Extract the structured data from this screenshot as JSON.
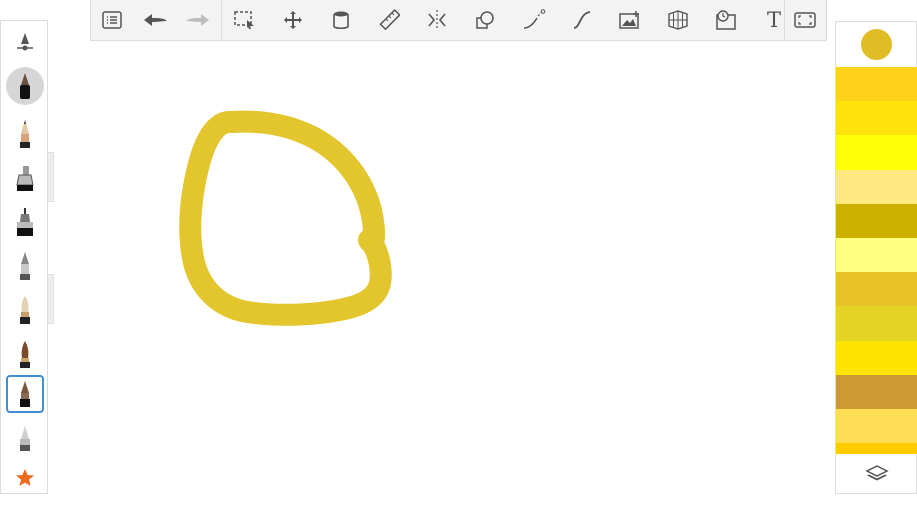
{
  "toolbar": {
    "items": [
      {
        "name": "list-menu-icon"
      },
      {
        "name": "undo-icon"
      },
      {
        "name": "redo-icon"
      },
      {
        "name": "selection-icon"
      },
      {
        "name": "transform-icon"
      },
      {
        "name": "fill-bucket-icon"
      },
      {
        "name": "ruler-icon"
      },
      {
        "name": "symmetry-icon"
      },
      {
        "name": "shapes-icon"
      },
      {
        "name": "predictive-stroke-icon"
      },
      {
        "name": "curve-icon"
      },
      {
        "name": "add-image-icon"
      },
      {
        "name": "perspective-grid-icon"
      },
      {
        "name": "time-lapse-icon"
      },
      {
        "name": "text-icon",
        "label": "T"
      },
      {
        "name": "fullscreen-icon"
      }
    ]
  },
  "brushes": [
    {
      "name": "brush-properties-icon"
    },
    {
      "name": "inking-pen-brush",
      "state": "active"
    },
    {
      "name": "pencil-brush"
    },
    {
      "name": "marker-brush"
    },
    {
      "name": "technical-pen-brush"
    },
    {
      "name": "ballpoint-brush"
    },
    {
      "name": "fountain-pen-brush"
    },
    {
      "name": "paintbrush-brush"
    },
    {
      "name": "airbrush-brush",
      "state": "selected"
    },
    {
      "name": "eraser-brush"
    },
    {
      "name": "favorites-star-icon"
    }
  ],
  "colors": {
    "current": "#e0bd26",
    "stroke": "#e2c222",
    "swatches": [
      "#ffd21a",
      "#ffe30a",
      "#ffff0a",
      "#ffe880",
      "#ccb000",
      "#ffff80",
      "#e6c226",
      "#e5d325",
      "#ffe300",
      "#cc9933",
      "#ffdd55",
      "#ffcc00"
    ]
  }
}
